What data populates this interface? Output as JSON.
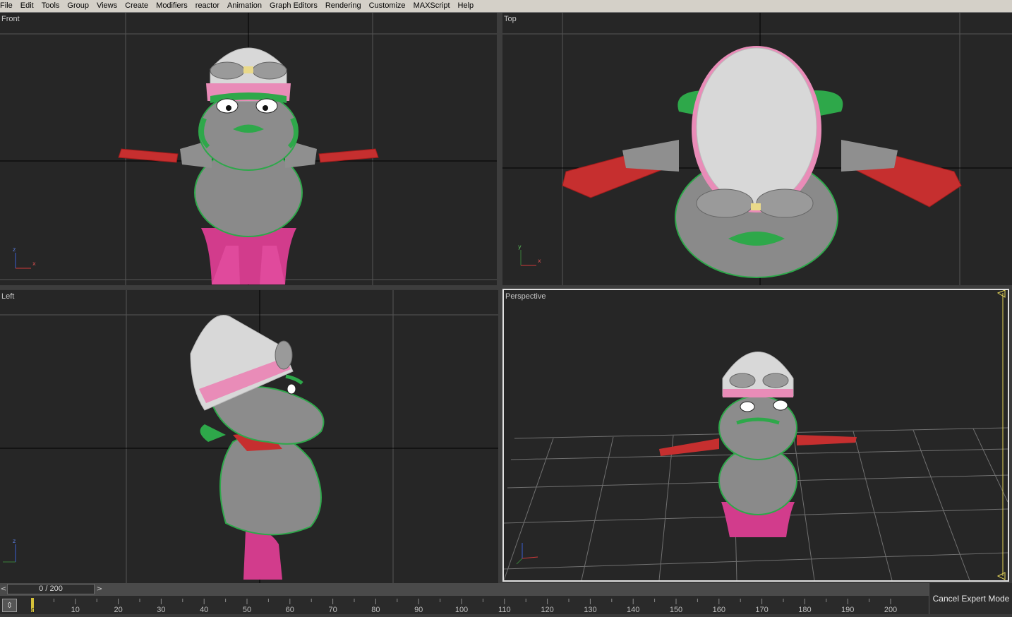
{
  "menubar": {
    "items": [
      "File",
      "Edit",
      "Tools",
      "Group",
      "Views",
      "Create",
      "Modifiers",
      "reactor",
      "Animation",
      "Graph Editors",
      "Rendering",
      "Customize",
      "MAXScript",
      "Help"
    ]
  },
  "viewports": {
    "front": {
      "label": "Front"
    },
    "top": {
      "label": "Top"
    },
    "left": {
      "label": "Left"
    },
    "perspective": {
      "label": "Perspective"
    }
  },
  "axis_gizmo": {
    "x": "x",
    "y": "y",
    "z": "z"
  },
  "timeline": {
    "frame_display": "0 / 200",
    "prev_glyph": "<",
    "next_glyph": ">",
    "ticks": [
      "10",
      "20",
      "30",
      "40",
      "50",
      "60",
      "70",
      "80",
      "90",
      "100",
      "110",
      "120",
      "130",
      "140",
      "150",
      "160",
      "170",
      "180",
      "190",
      "200"
    ],
    "current_frame_marker": "0"
  },
  "buttons": {
    "cancel_expert": "Cancel Expert Mode"
  },
  "colors": {
    "viewport_bg": "#262626",
    "grid": "#5a5a5a",
    "mesh_green": "#2ea84a",
    "mesh_pink": "#e0338a",
    "mesh_red": "#cc2a2a",
    "mesh_gray": "#9a9a9a"
  }
}
